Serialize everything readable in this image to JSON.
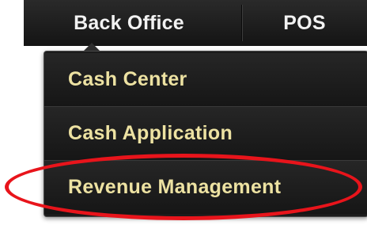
{
  "nav": {
    "tabs": [
      {
        "label": "Back Office"
      },
      {
        "label": "POS"
      }
    ]
  },
  "menu": {
    "items": [
      {
        "label": "Cash Center"
      },
      {
        "label": "Cash Application"
      },
      {
        "label": "Revenue Management"
      }
    ],
    "highlighted_item": "Revenue Management"
  },
  "colors": {
    "bar_background": "#1a1a1a",
    "menu_text": "#ede2a2",
    "tab_text": "#f2f2f2",
    "highlight_ring": "#e8141b"
  }
}
